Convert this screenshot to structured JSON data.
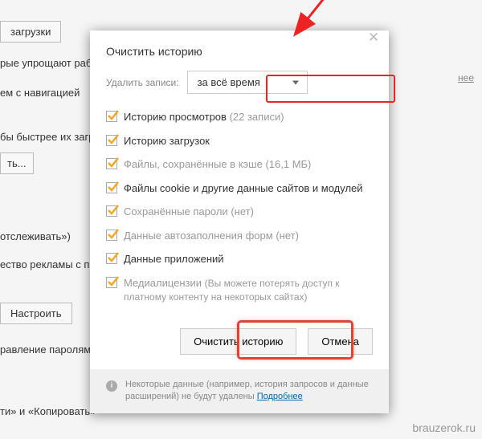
{
  "background": {
    "downloads_button": "загрузки",
    "simplify_text": "рые упрощают рабо",
    "navigation_text": "ем с навигацией",
    "faster_text": "бы быстрее их загр",
    "ellipsis_button": "ть...",
    "track_text": "отслеживать»)",
    "ads_quality_text": "ество рекламы с по",
    "configure_button": "Настроить",
    "password_mgmt_text": "равление паролями",
    "copy_text": "ти» и «Копировать»",
    "more_link": "нее"
  },
  "dialog": {
    "title": "Очистить историю",
    "delete_label": "Удалить записи:",
    "select_value": "за всё время",
    "checkboxes": [
      {
        "label": "Историю просмотров",
        "suffix": "(22 записи)",
        "checked": true
      },
      {
        "label": "Историю загрузок",
        "suffix": "",
        "checked": true
      },
      {
        "label": "Файлы, сохранённые в кэше",
        "suffix": "(16,1 МБ)",
        "checked": true,
        "all_muted": true
      },
      {
        "label": "Файлы cookie и другие данные сайтов и модулей",
        "suffix": "",
        "checked": true
      },
      {
        "label": "Сохранённые пароли",
        "suffix": "(нет)",
        "checked": true,
        "all_muted": true
      },
      {
        "label": "Данные автозаполнения форм",
        "suffix": "(нет)",
        "checked": true,
        "all_muted": true
      },
      {
        "label": "Данные приложений",
        "suffix": "",
        "checked": true
      },
      {
        "label": "Медиалицензии",
        "suffix": "(Вы можете потерять доступ к платному контенту на некоторых сайтах)",
        "checked": true,
        "all_muted": true
      }
    ],
    "primary_button": "Очистить историю",
    "cancel_button": "Отмена",
    "footer_text": "Некоторые данные (например, история запросов и данные расширений) не будут удалены",
    "footer_link": "Подробнее"
  },
  "watermark": "brauzerok.ru"
}
